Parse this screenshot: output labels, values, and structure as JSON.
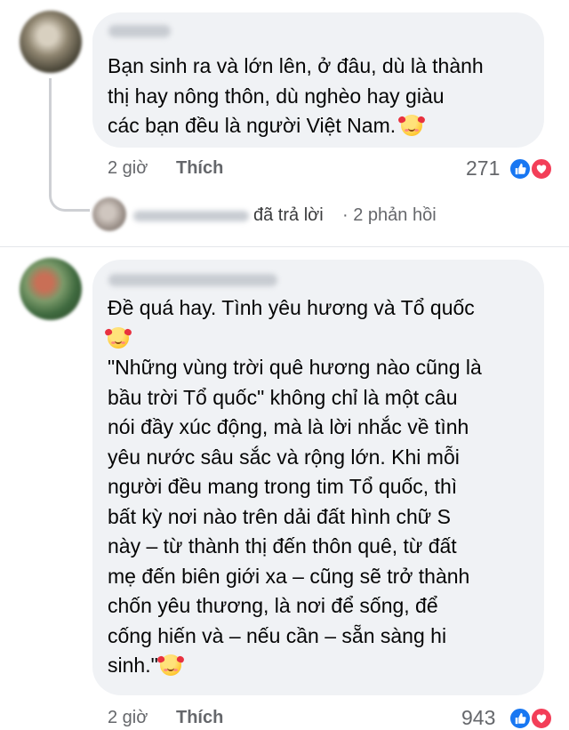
{
  "comments": [
    {
      "author": "Tuấn Chi",
      "text": "Bạn sinh ra và lớn lên, ở đâu, dù là thành\nthị hay nông thôn, dù nghèo hay giàu\ncác bạn đều là người Việt Nam.",
      "time": "2 giờ",
      "like_label": "Thích",
      "reaction_count": "271",
      "reactions": [
        "like-icon",
        "love-icon"
      ],
      "reply_summary": {
        "author": "Hằng Hằng",
        "action": "đã trả lời",
        "count": "· 2 phản hồi"
      }
    },
    {
      "author": "Cao Trung Nguyên",
      "text": "Đề quá hay. Tình yêu hương và Tổ quốc\n",
      "text2": "\n\"Những vùng trời quê hương nào cũng là\nbầu trời Tổ quốc\" không chỉ là một câu\nnói đầy xúc động, mà là lời nhắc về tình\nyêu nước sâu sắc và rộng lớn. Khi mỗi\nngười đều mang trong tim Tổ quốc, thì\nbất kỳ nơi nào trên dải đất hình chữ S\nnày – từ thành thị đến thôn quê, từ đất\nmẹ đến biên giới xa – cũng sẽ trở thành\nchốn yêu thương, là nơi để sống, để\ncống hiến và – nếu cần – sẵn sàng hi\nsinh.\"",
      "time": "2 giờ",
      "like_label": "Thích",
      "reaction_count": "943",
      "reactions": [
        "like-icon",
        "love-icon"
      ]
    }
  ],
  "colors": {
    "bubble": "#f0f2f5",
    "like_blue": "#1877f2",
    "love_red": "#f33e58",
    "meta_gray": "#65676b"
  }
}
